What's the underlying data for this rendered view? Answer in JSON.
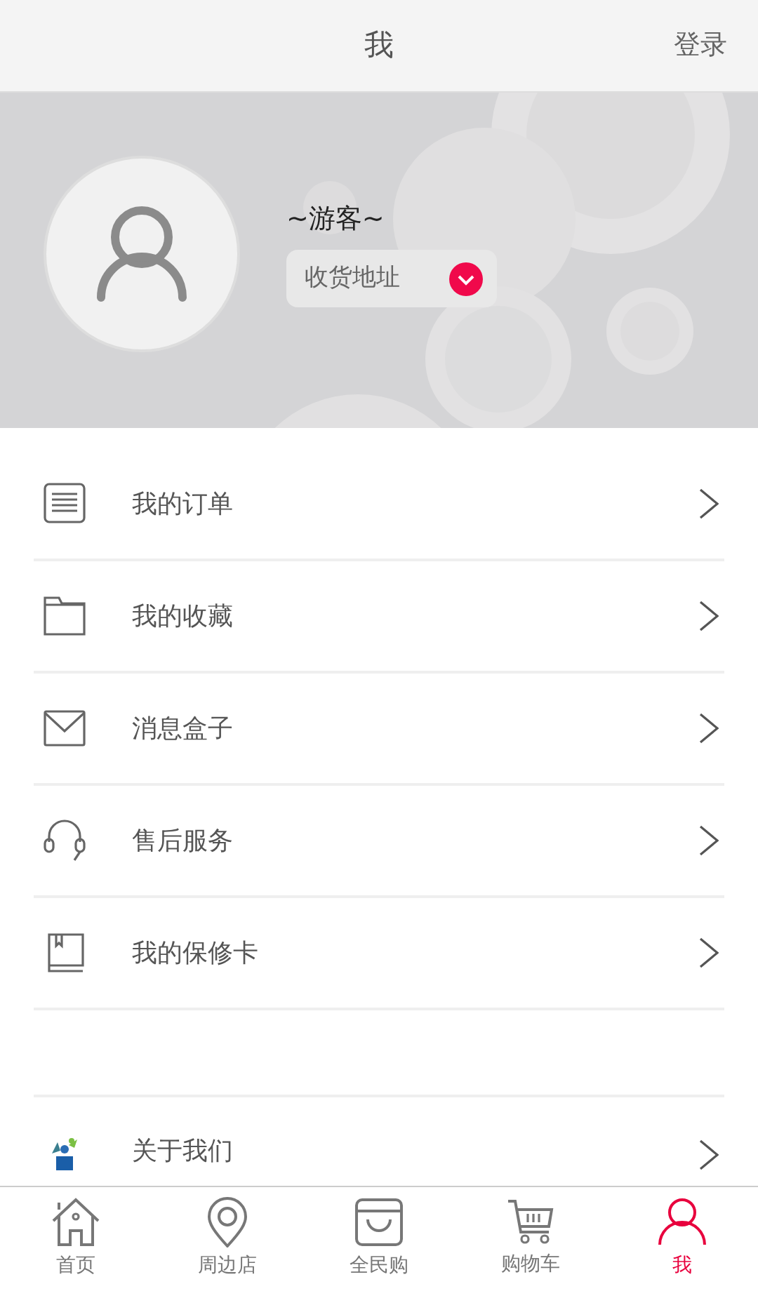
{
  "header": {
    "title": "我",
    "login": "登录"
  },
  "profile": {
    "name": "~游客~",
    "address_button": "收货地址"
  },
  "menu": [
    {
      "label": "我的订单"
    },
    {
      "label": "我的收藏"
    },
    {
      "label": "消息盒子"
    },
    {
      "label": "售后服务"
    },
    {
      "label": "我的保修卡"
    }
  ],
  "extra_menu": [
    {
      "label": "关于我们"
    }
  ],
  "tabbar": [
    {
      "label": "首页",
      "selected": false
    },
    {
      "label": "周边店",
      "selected": false
    },
    {
      "label": "全民购",
      "selected": false
    },
    {
      "label": "购物车",
      "selected": false
    },
    {
      "label": "我",
      "selected": true
    }
  ]
}
